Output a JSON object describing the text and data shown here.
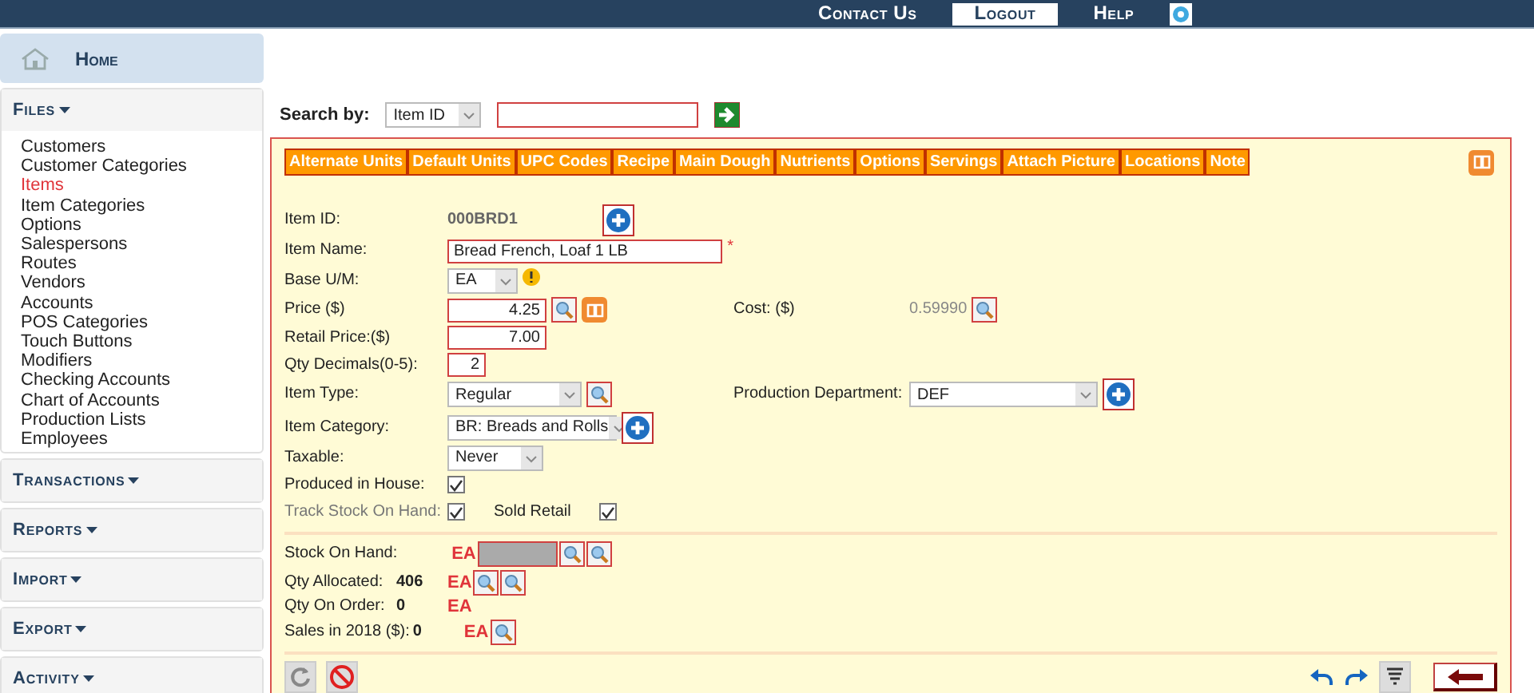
{
  "top_nav": [
    {
      "label": "Contact Us",
      "selected": false
    },
    {
      "label": "Logout",
      "selected": true
    },
    {
      "label": "Help",
      "selected": false
    }
  ],
  "sidebar": {
    "home": "Home",
    "sections": [
      {
        "title": "Files",
        "expanded": true,
        "items": [
          {
            "label": "Customers",
            "selected": false
          },
          {
            "label": "Customer Categories",
            "selected": false
          },
          {
            "label": "Items",
            "selected": true
          },
          {
            "label": "Item Categories",
            "selected": false
          },
          {
            "label": "Options",
            "selected": false
          },
          {
            "label": "Salespersons",
            "selected": false
          },
          {
            "label": "Routes",
            "selected": false
          },
          {
            "label": "Vendors",
            "selected": false
          },
          {
            "label": "Accounts",
            "selected": false
          },
          {
            "label": "POS Categories",
            "selected": false
          },
          {
            "label": "Touch Buttons",
            "selected": false
          },
          {
            "label": "Modifiers",
            "selected": false
          },
          {
            "label": "Checking Accounts",
            "selected": false
          },
          {
            "label": "Chart of Accounts",
            "selected": false
          },
          {
            "label": "Production Lists",
            "selected": false
          },
          {
            "label": "Employees",
            "selected": false
          }
        ]
      },
      {
        "title": "Transactions",
        "expanded": false
      },
      {
        "title": "Reports",
        "expanded": false
      },
      {
        "title": "Import",
        "expanded": false
      },
      {
        "title": "Export",
        "expanded": false
      },
      {
        "title": "Activity",
        "expanded": false
      }
    ]
  },
  "search": {
    "label": "Search by:",
    "field": "Item ID"
  },
  "tabs": [
    "Alternate Units",
    "Default Units",
    "UPC Codes",
    "Recipe",
    "Main Dough",
    "Nutrients",
    "Options",
    "Servings",
    "Attach Picture",
    "Locations",
    "Note"
  ],
  "rows": [
    {
      "left": {
        "label": "Item ID:",
        "kind": "static",
        "value": "000BRD1"
      }
    },
    {
      "left": {
        "label": "Item Name:",
        "kind": "input",
        "value": "Bread French, Loaf 1 LB",
        "required_mark": "*"
      }
    },
    {
      "left": {
        "label": "Base U/M:",
        "kind": "select",
        "value": "EA",
        "warning": true
      }
    },
    {
      "left": {
        "label": "Price ($)",
        "kind": "input",
        "value": "4.25"
      },
      "right": {
        "label": "Cost: ($)",
        "kind": "static",
        "value": "0.59990",
        "muted": true
      }
    },
    {
      "left": {
        "label": "Retail Price:($)",
        "kind": "input",
        "value": "7.00"
      }
    },
    {
      "left": {
        "label": "Qty Decimals(0-5):",
        "kind": "input",
        "value": "2"
      }
    },
    {
      "left": {
        "label": "Item Type:",
        "kind": "select",
        "value": "Regular"
      },
      "right": {
        "label": "Production Department:",
        "kind": "select",
        "value": "DEF"
      }
    },
    {
      "left": {
        "label": "Item Category:",
        "kind": "select",
        "value": "BR: Breads and Rolls"
      }
    },
    {
      "left": {
        "label": "Taxable:",
        "kind": "select",
        "value": "Never"
      }
    }
  ],
  "checks": [
    {
      "label": "Produced in House:",
      "checked": true,
      "disabled": false
    },
    {
      "label": "Track Stock On Hand:",
      "checked": true,
      "disabled": true,
      "extra": {
        "label": "Sold Retail",
        "checked": true
      }
    }
  ],
  "stock": [
    {
      "label": "Stock On Hand:",
      "unit": "EA",
      "blurred": true
    },
    {
      "label": "Qty Allocated:",
      "value": "406",
      "unit": "EA"
    },
    {
      "label": "Qty On Order:",
      "value": "0",
      "unit": "EA"
    },
    {
      "label": "Sales in 2018 ($):",
      "value": "0",
      "unit": "EA"
    }
  ]
}
